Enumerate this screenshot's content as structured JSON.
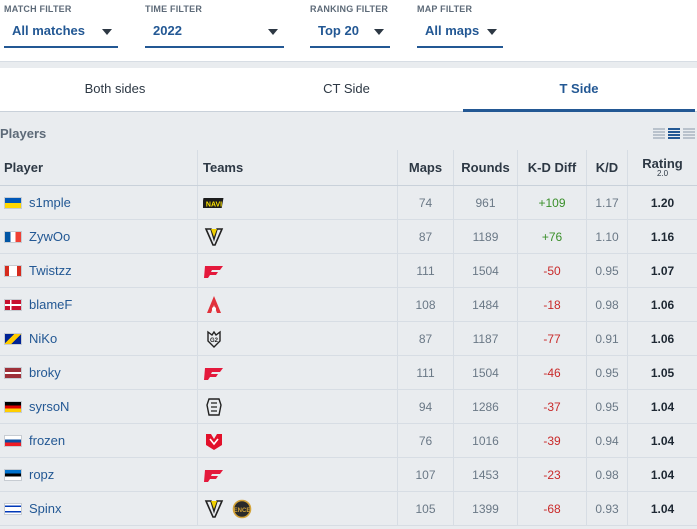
{
  "filters": [
    {
      "label": "MATCH FILTER",
      "value": "All matches"
    },
    {
      "label": "TIME FILTER",
      "value": "2022"
    },
    {
      "label": "RANKING FILTER",
      "value": "Top 20"
    },
    {
      "label": "MAP FILTER",
      "value": "All maps"
    }
  ],
  "tabs": [
    "Both sides",
    "CT Side",
    "T Side"
  ],
  "active_tab": "T Side",
  "players_title": "Players",
  "columns": {
    "player": "Player",
    "teams": "Teams",
    "maps": "Maps",
    "rounds": "Rounds",
    "kd_diff": "K-D Diff",
    "kd": "K/D",
    "rating": "Rating",
    "rating_version": "2.0"
  },
  "rows": [
    {
      "name": "s1mple",
      "flag": "ukraine",
      "teams": [
        "navi-logo"
      ],
      "maps": "74",
      "rounds": "961",
      "kd_diff": "+109",
      "kd": "1.17",
      "rating": "1.20"
    },
    {
      "name": "ZywOo",
      "flag": "france",
      "teams": [
        "vitality-logo"
      ],
      "maps": "87",
      "rounds": "1189",
      "kd_diff": "+76",
      "kd": "1.10",
      "rating": "1.16"
    },
    {
      "name": "Twistzz",
      "flag": "canada",
      "teams": [
        "faze-logo"
      ],
      "maps": "111",
      "rounds": "1504",
      "kd_diff": "-50",
      "kd": "0.95",
      "rating": "1.07"
    },
    {
      "name": "blameF",
      "flag": "denmark",
      "teams": [
        "astralis-logo"
      ],
      "maps": "108",
      "rounds": "1484",
      "kd_diff": "-18",
      "kd": "0.98",
      "rating": "1.06"
    },
    {
      "name": "NiKo",
      "flag": "bosnia",
      "teams": [
        "g2-logo"
      ],
      "maps": "87",
      "rounds": "1187",
      "kd_diff": "-77",
      "kd": "0.91",
      "rating": "1.06"
    },
    {
      "name": "broky",
      "flag": "latvia",
      "teams": [
        "faze-logo"
      ],
      "maps": "111",
      "rounds": "1504",
      "kd_diff": "-46",
      "kd": "0.95",
      "rating": "1.05"
    },
    {
      "name": "syrsoN",
      "flag": "germany",
      "teams": [
        "big-logo"
      ],
      "maps": "94",
      "rounds": "1286",
      "kd_diff": "-37",
      "kd": "0.95",
      "rating": "1.04"
    },
    {
      "name": "frozen",
      "flag": "slovakia",
      "teams": [
        "mouz-logo"
      ],
      "maps": "76",
      "rounds": "1016",
      "kd_diff": "-39",
      "kd": "0.94",
      "rating": "1.04"
    },
    {
      "name": "ropz",
      "flag": "estonia",
      "teams": [
        "faze-logo"
      ],
      "maps": "107",
      "rounds": "1453",
      "kd_diff": "-23",
      "kd": "0.98",
      "rating": "1.04"
    },
    {
      "name": "Spinx",
      "flag": "israel",
      "teams": [
        "vitality-logo",
        "ence-logo"
      ],
      "maps": "105",
      "rounds": "1399",
      "kd_diff": "-68",
      "kd": "0.93",
      "rating": "1.04"
    }
  ],
  "colors": {
    "accent": "#235894",
    "positive": "#3a8f2a",
    "negative": "#c92a2a"
  }
}
